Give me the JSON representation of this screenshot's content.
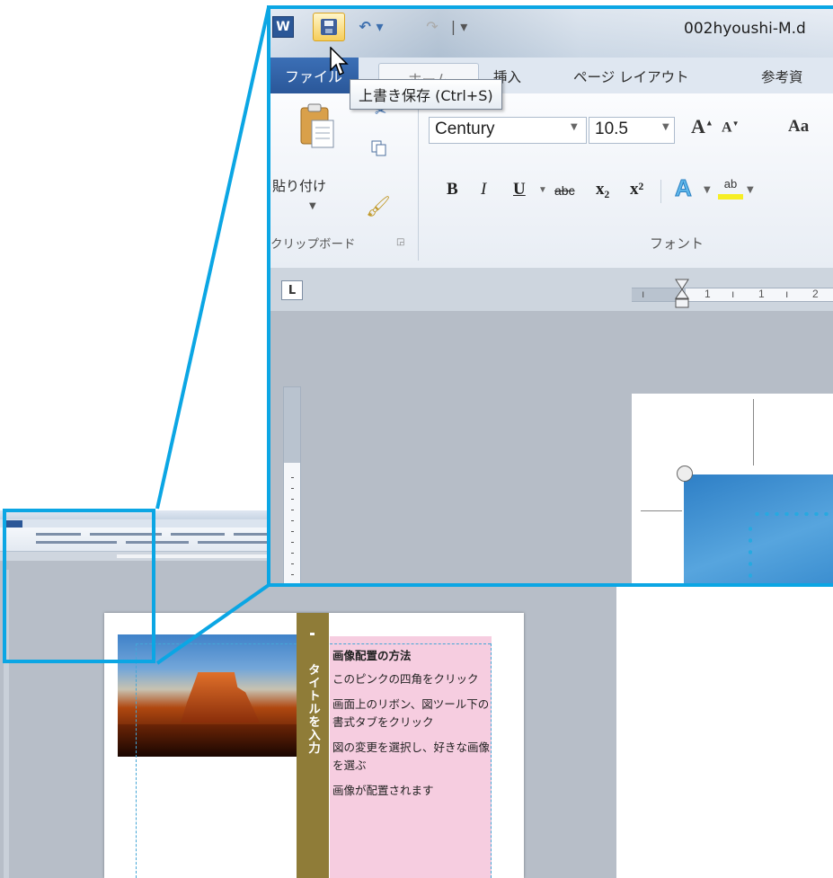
{
  "window": {
    "app_logo": "W",
    "doc_title": "002hyoushi-M.d",
    "qat": {
      "undo_glyph": "↶ ▾",
      "redo_glyph": "↷",
      "customize_glyph": "| ▾"
    }
  },
  "tabs": {
    "file": "ファイル",
    "home": "ホーム",
    "insert": "挿入",
    "page_layout": "ページ レイアウト",
    "references": "参考資"
  },
  "tooltip": "上書き保存 (Ctrl+S)",
  "ribbon": {
    "paste_label": "貼り付け",
    "clipboard_group": "クリップボード",
    "font_name": "Century",
    "font_size": "10.5",
    "grow_glyph": "A",
    "shrink_glyph": "A",
    "change_case": "Aa",
    "bold": "B",
    "italic": "I",
    "underline": "U",
    "strikethrough": "abc",
    "subscript": "x₂",
    "superscript": "x²",
    "text_effect": "A",
    "highlight": "ab",
    "font_group": "フォント"
  },
  "ruler": {
    "tab_selector": "L",
    "ticks": [
      "1",
      "1",
      "2"
    ]
  },
  "document": {
    "vertical_title": "タイトルを入力",
    "howto_heading": "画像配置の方法",
    "steps": [
      "このピンクの四角をクリック",
      "画面上のリボン、図ツール下の書式タブをクリック",
      "図の変更を選択し、好きな画像を選ぶ",
      "画像が配置されます"
    ]
  },
  "icons": {
    "save": "save-disk-icon",
    "cursor": "mouse-cursor-icon",
    "paste": "clipboard-paste-icon",
    "cut": "scissors-icon",
    "copy": "copy-icon",
    "format_painter": "paintbrush-icon"
  },
  "colors": {
    "callout": "#0ba6e4",
    "file_tab": "#2b5797",
    "title_band": "#8f7c38",
    "pink_box": "#f6cde0"
  }
}
